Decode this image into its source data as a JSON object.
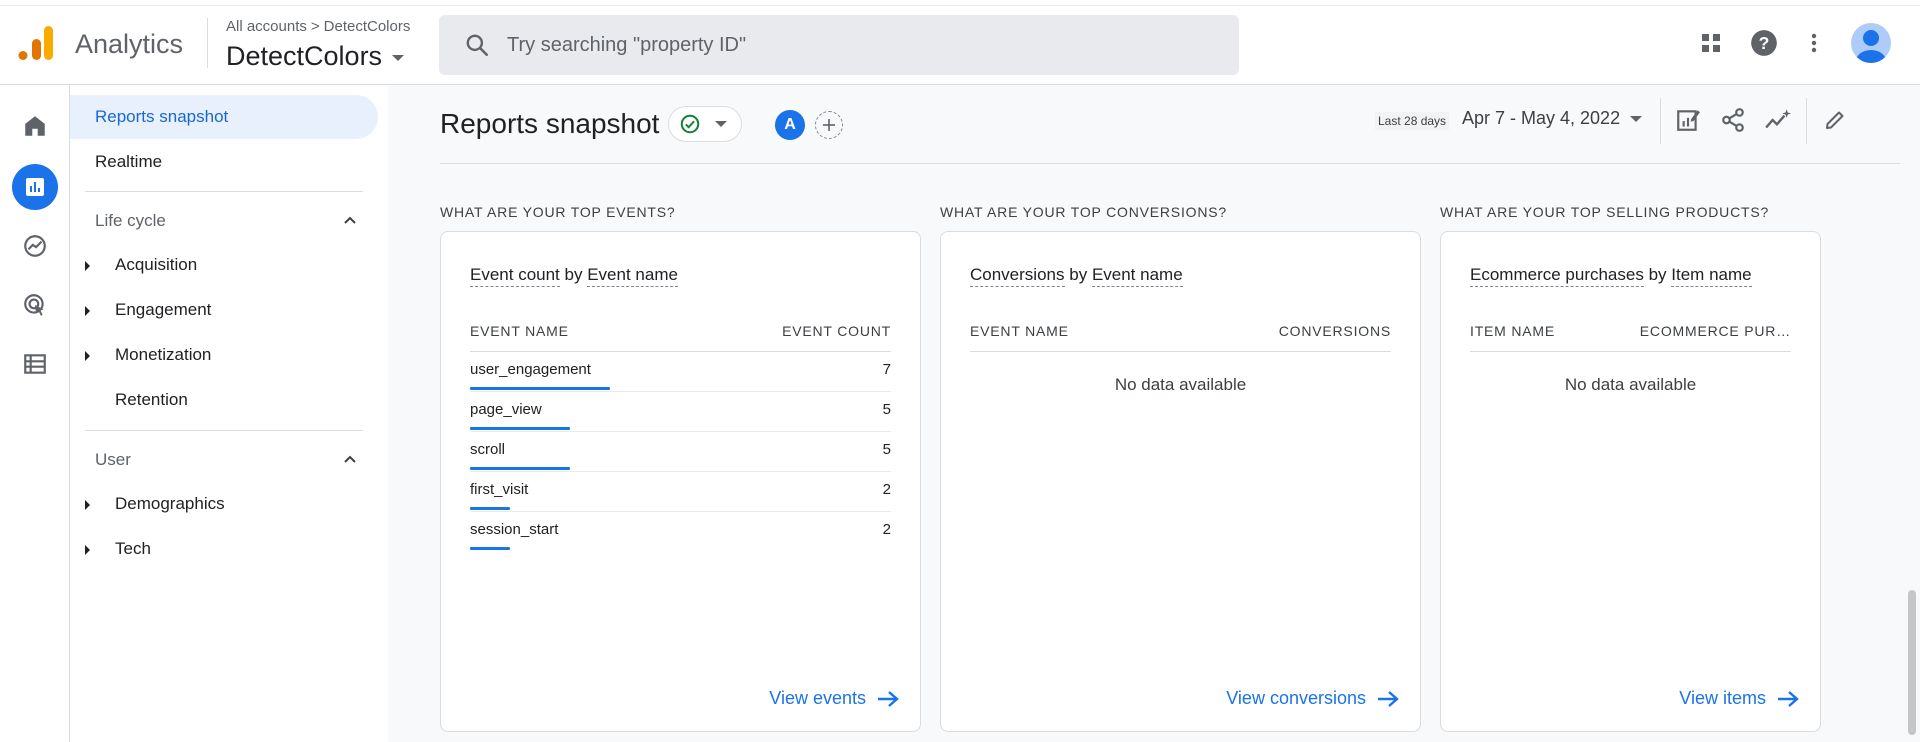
{
  "app": {
    "name": "Analytics"
  },
  "breadcrumb": {
    "accounts": "All accounts",
    "separator": ">",
    "account": "DetectColors"
  },
  "property": {
    "name": "DetectColors"
  },
  "search": {
    "placeholder": "Try searching \"property ID\""
  },
  "topbar_icons": [
    "apps-grid-icon",
    "help-icon",
    "more-vert-icon",
    "account-avatar"
  ],
  "rail": [
    "home-icon",
    "reports-icon",
    "explore-icon",
    "advertising-icon",
    "configure-icon"
  ],
  "nav": {
    "reports_snapshot": "Reports snapshot",
    "realtime": "Realtime",
    "lifecycle": {
      "title": "Life cycle",
      "items": [
        "Acquisition",
        "Engagement",
        "Monetization",
        "Retention"
      ]
    },
    "user": {
      "title": "User",
      "items": [
        "Demographics",
        "Tech"
      ]
    }
  },
  "header": {
    "title": "Reports snapshot",
    "compare_letter": "A",
    "date_label": "Last 28 days",
    "date_range": "Apr 7 - May 4, 2022"
  },
  "cards": {
    "events": {
      "heading": "WHAT ARE YOUR TOP EVENTS?",
      "metric": "Event count",
      "by": "by",
      "dimension": "Event name",
      "col_left": "EVENT NAME",
      "col_right": "EVENT COUNT",
      "rows": [
        {
          "name": "user_engagement",
          "value": "7"
        },
        {
          "name": "page_view",
          "value": "5"
        },
        {
          "name": "scroll",
          "value": "5"
        },
        {
          "name": "first_visit",
          "value": "2"
        },
        {
          "name": "session_start",
          "value": "2"
        }
      ],
      "link": "View events"
    },
    "conversions": {
      "heading": "WHAT ARE YOUR TOP CONVERSIONS?",
      "metric": "Conversions",
      "by": "by",
      "dimension": "Event name",
      "col_left": "EVENT NAME",
      "col_right": "CONVERSIONS",
      "empty": "No data available",
      "link": "View conversions"
    },
    "products": {
      "heading": "WHAT ARE YOUR TOP SELLING PRODUCTS?",
      "metric": "Ecommerce purchases",
      "by": "by",
      "dimension": "Item name",
      "col_left": "ITEM NAME",
      "col_right": "ECOMMERCE PUR…",
      "empty": "No data available",
      "link": "View items"
    }
  },
  "colors": {
    "accent": "#1a73e8",
    "logo_orange": "#f9ab00",
    "logo_dark_orange": "#e37400",
    "success": "#188038"
  }
}
